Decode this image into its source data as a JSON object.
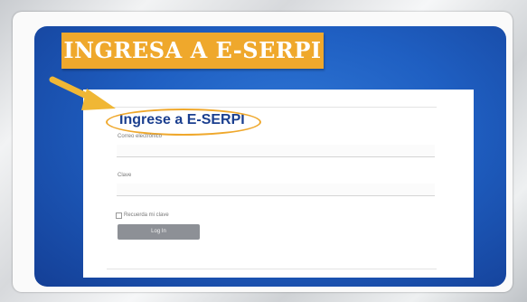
{
  "banner": {
    "title": "INGRESA A E-SERPI"
  },
  "login": {
    "title": "Ingrese a E-SERPI",
    "email_label": "Correo electrónico",
    "password_label": "Clave",
    "remember_label": "Recuerda mi clave",
    "submit_label": "Log In"
  },
  "colors": {
    "banner": "#efa82c",
    "highlight": "#efa82c",
    "panel_blue": "#1f5fc2",
    "title_text": "#1b3f8f",
    "button": "#8d9096"
  },
  "icons": {
    "pointer": "arrow-pointer-icon"
  }
}
